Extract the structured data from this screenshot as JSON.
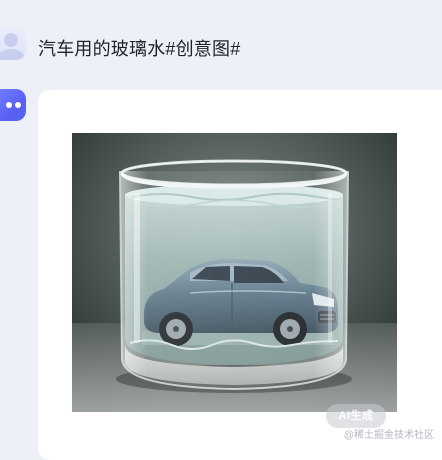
{
  "conversation": {
    "user_message": "汽车用的玻璃水#创意图#",
    "response": {
      "image_badge": "AI生成",
      "watermark": "@稀土掘金技术社区"
    }
  }
}
